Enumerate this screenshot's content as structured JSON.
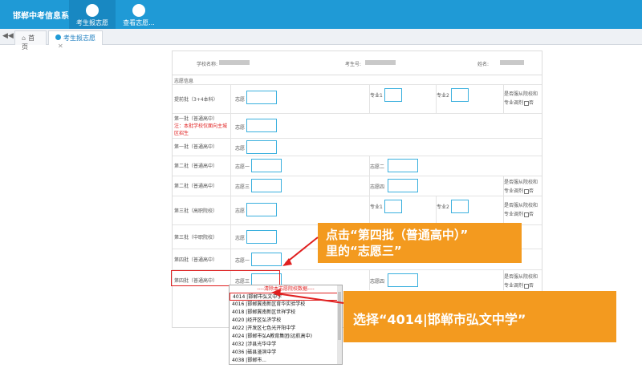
{
  "app": {
    "title": "邯郸中考信息系统",
    "nav": [
      "考生报志愿",
      "查看志愿..."
    ]
  },
  "tabs": [
    {
      "icon": "home-icon",
      "label": "首页"
    },
    {
      "icon": "globe-icon",
      "label": "考生报志愿",
      "close": "✕"
    }
  ],
  "header": {
    "school_label": "学校名称:",
    "id_label": "考生号:",
    "name_label": "姓名:"
  },
  "section_title": "志愿信息",
  "labels": {
    "wish": "志愿",
    "wish1": "志愿一",
    "wish2": "志愿二",
    "wish3": "志愿三",
    "wish4": "志愿四",
    "major1": "专业1",
    "major2": "专业2",
    "adjust_line1": "是否服从院校和",
    "adjust_line2": "专业调剂"
  },
  "rows": {
    "r1": "提前批（3+4本科）",
    "r2": "第一批（普通高中）",
    "r2_note": "注：本批学校仅面向主城区招生",
    "r3": "第一批（普通高中）",
    "r4": "第二批（普通高中）",
    "r5": "第二批（普通高中）",
    "r6": "第三批（高职院校）",
    "r7": "第三批（中职院校）",
    "r8": "第四批（普通高中）",
    "r9": "第四批（普通高中）"
  },
  "dropdown": {
    "header": "----清除本志愿院校数据----",
    "items": [
      "4014 |邯郸市弘文中学",
      "4016 |邯郸冀南新区育华实验学校",
      "4018 |邯郸冀南新区世祥学校",
      "4020 |经开区弘济学校",
      "4022 |开发区七色光开阳中学",
      "4024 |邯郸市弘A教育集团(远航高中)",
      "4032 |涉县光华中学",
      "4036 |磁县滏滨中学",
      "4038 |邯郸市..."
    ]
  },
  "callouts": {
    "c1_line1": "点击“第四批（普通高中）”",
    "c1_line2": "里的“志愿三”",
    "c2": "选择“4014|邯郸市弘文中学”"
  },
  "colors": {
    "brand": "#1f9ad6",
    "accent": "#f39a1f",
    "highlight": "#e02020"
  }
}
